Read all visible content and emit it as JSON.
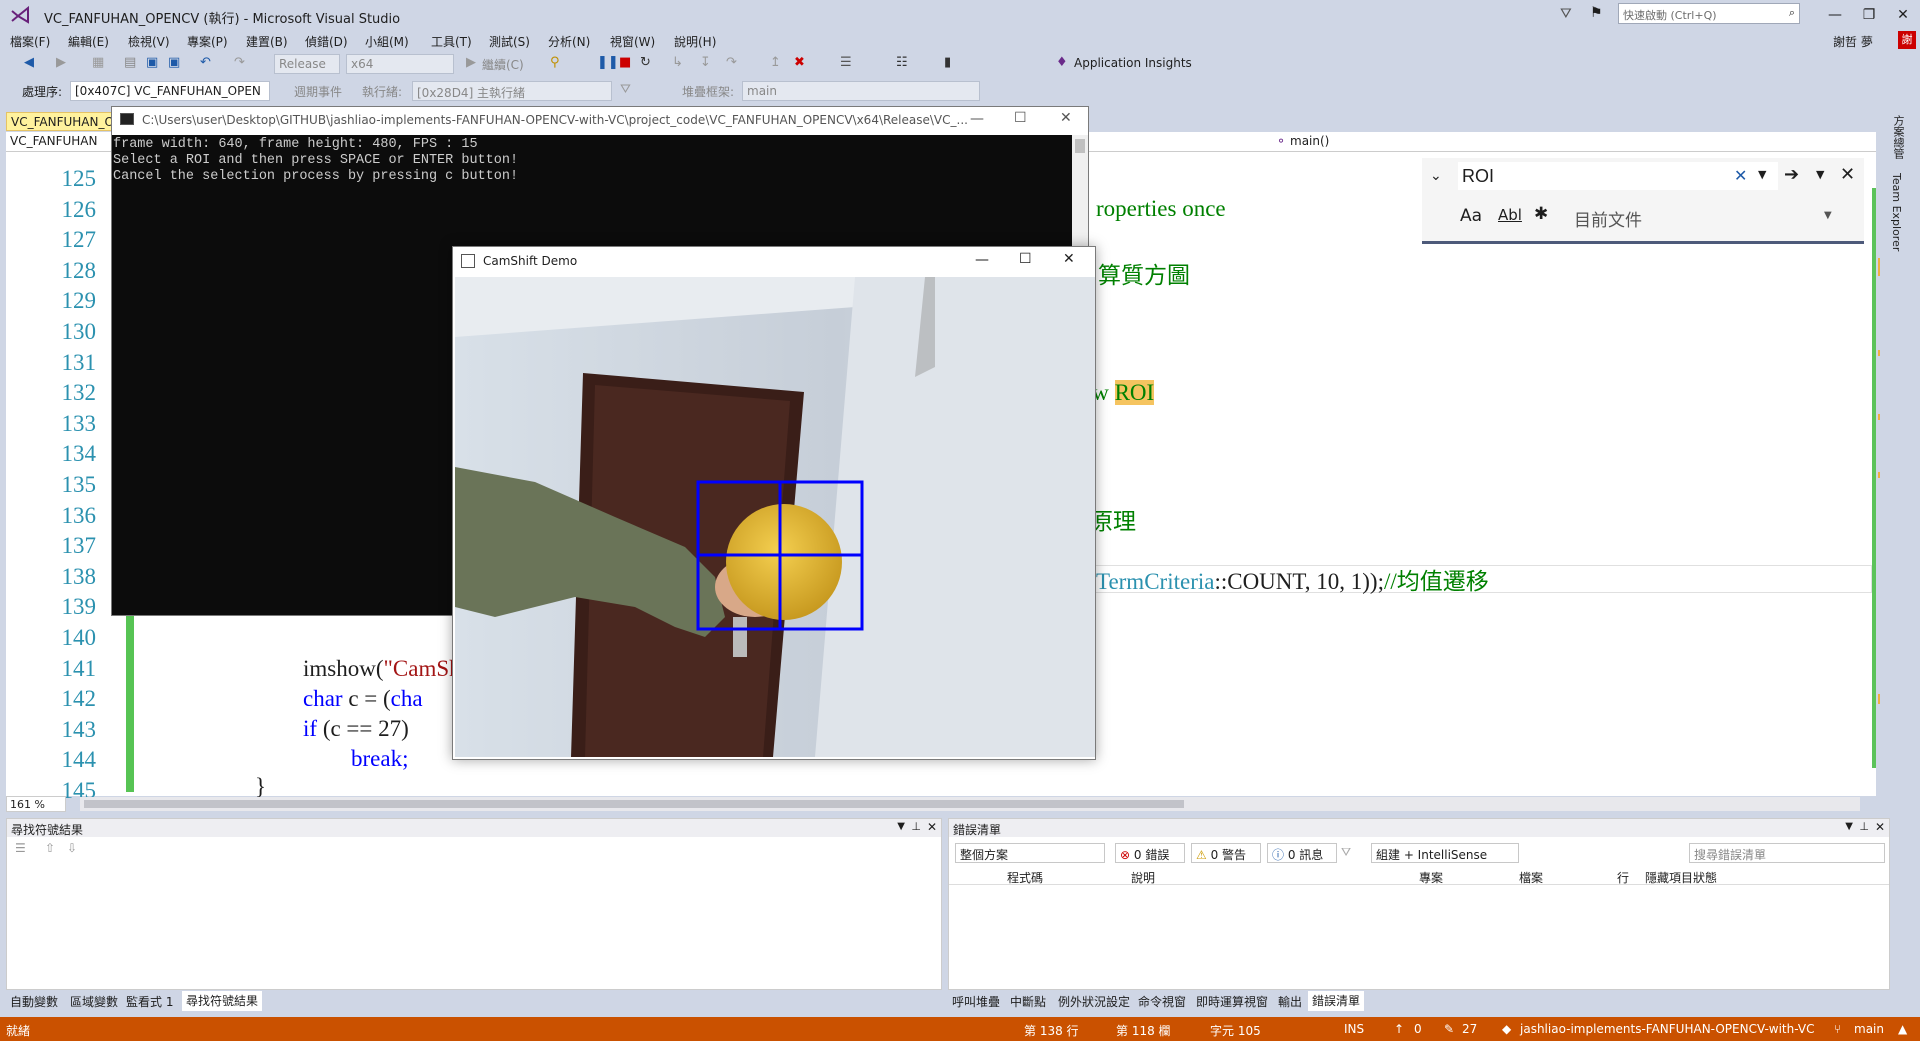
{
  "window": {
    "title": "VC_FANFUHAN_OPENCV (執行) - Microsoft Visual Studio",
    "quick_launch_placeholder": "快速啟動 (Ctrl+Q)",
    "user": "謝哲 夢",
    "user_initial": "謝"
  },
  "menu": [
    "檔案(F)",
    "編輯(E)",
    "檢視(V)",
    "專案(P)",
    "建置(B)",
    "偵錯(D)",
    "小組(M)",
    "工具(T)",
    "測試(S)",
    "分析(N)",
    "視窗(W)",
    "說明(H)"
  ],
  "toolbar": {
    "config": "Release",
    "platform": "x64",
    "continue_label": "繼續(C)",
    "app_insights": "Application Insights"
  },
  "debug_toolbar": {
    "process_label": "處理序:",
    "process_value": "[0x407C] VC_FANFUHAN_OPEN",
    "lifecycle_label": "週期事件",
    "thread_label": "執行緒:",
    "thread_value": "[0x28D4] 主執行緒",
    "stack_label": "堆疊框架:",
    "stack_value": "main"
  },
  "editor": {
    "tab_label": "VC_FANFUHAN_O",
    "nav_project": "VC_FANFUHAN",
    "nav_function": "main()",
    "zoom": "161 %",
    "lines": [
      {
        "n": "125",
        "tail": "roperties once",
        "tail_class": "cm"
      },
      {
        "n": "126",
        "tail": "算質方圖",
        "tail_class": "cm"
      },
      {
        "n": "127",
        "tail": ""
      },
      {
        "n": "128",
        "tail": ""
      },
      {
        "n": "129",
        "tail": ""
      },
      {
        "n": "130",
        "tail": "w ROI",
        "tail_class": "cm"
      },
      {
        "n": "131",
        "tail": ""
      },
      {
        "n": "132",
        "tail": ""
      },
      {
        "n": "133",
        "tail": "原理",
        "tail_class": "cm"
      },
      {
        "n": "134",
        "tail": ""
      },
      {
        "n": "135",
        "tail": ""
      },
      {
        "n": "136",
        "tail": ""
      },
      {
        "n": "137",
        "tail": ""
      },
      {
        "n": "138",
        "tail": "TermCriteria::COUNT, 10, 1));//均值遷移"
      },
      {
        "n": "139",
        "tail": ""
      },
      {
        "n": "140",
        "tail": ""
      },
      {
        "n": "141",
        "tail": ""
      },
      {
        "n": "142",
        "tail": ""
      },
      {
        "n": "143",
        "tail": ""
      },
      {
        "n": "144",
        "tail": ""
      },
      {
        "n": "145",
        "tail": ""
      }
    ],
    "code_141": "imshow(\"CamSh",
    "code_142_kw": "char",
    "code_142_rest": " c = (",
    "code_142_kw2": "cha",
    "code_143_kw": "if",
    "code_143_rest": " (c == 27)",
    "code_144": "break;",
    "code_145": "}",
    "code_138_a": "TermCriteria",
    "code_138_b": "::COUNT, 10, 1));",
    "code_138_c": "//均值遷移",
    "roi_highlight": "ROI"
  },
  "find": {
    "query": "ROI",
    "scope": "目前文件",
    "opt_case": "Aa",
    "opt_word": "Abl"
  },
  "console": {
    "title": "C:\\Users\\user\\Desktop\\GITHUB\\jashliao-implements-FANFUHAN-OPENCV-with-VC\\project_code\\VC_FANFUHAN_OPENCV\\x64\\Release\\VC_...",
    "lines": [
      "frame width: 640, frame height: 480, FPS : 15",
      "Select a ROI and then press SPACE or ENTER button!",
      "Cancel the selection process by pressing c button!"
    ]
  },
  "camshift": {
    "title": "CamShift Demo"
  },
  "panels": {
    "left_title": "尋找符號結果",
    "right_title": "錯誤清單",
    "scope_select": "整個方案",
    "errors": "0 錯誤",
    "warnings": "0 警告",
    "messages": "0 訊息",
    "build_filter": "組建 + IntelliSense",
    "search_placeholder": "搜尋錯誤清單",
    "columns": [
      "程式碼",
      "說明",
      "專案",
      "檔案",
      "行",
      "隱藏項目狀態"
    ],
    "left_tabs": [
      "自動變數",
      "區域變數",
      "監看式 1",
      "尋找符號結果"
    ],
    "right_tabs": [
      "呼叫堆疊",
      "中斷點",
      "例外狀況設定",
      "命令視窗",
      "即時運算視窗",
      "輸出",
      "錯誤清單"
    ]
  },
  "side_tabs": [
    "方案總管",
    "Team Explorer"
  ],
  "status": {
    "state": "就緒",
    "line": "第 138 行",
    "col": "第 118 欄",
    "char": "字元 105",
    "ins": "INS",
    "up": "0",
    "edits": "27",
    "repo": "jashliao-implements-FANFUHAN-OPENCV-with-VC",
    "branch": "main"
  },
  "colors": {
    "status_bar": "#ca5100",
    "chrome": "#cfd6e5",
    "tracking_box": "#0000ff"
  }
}
